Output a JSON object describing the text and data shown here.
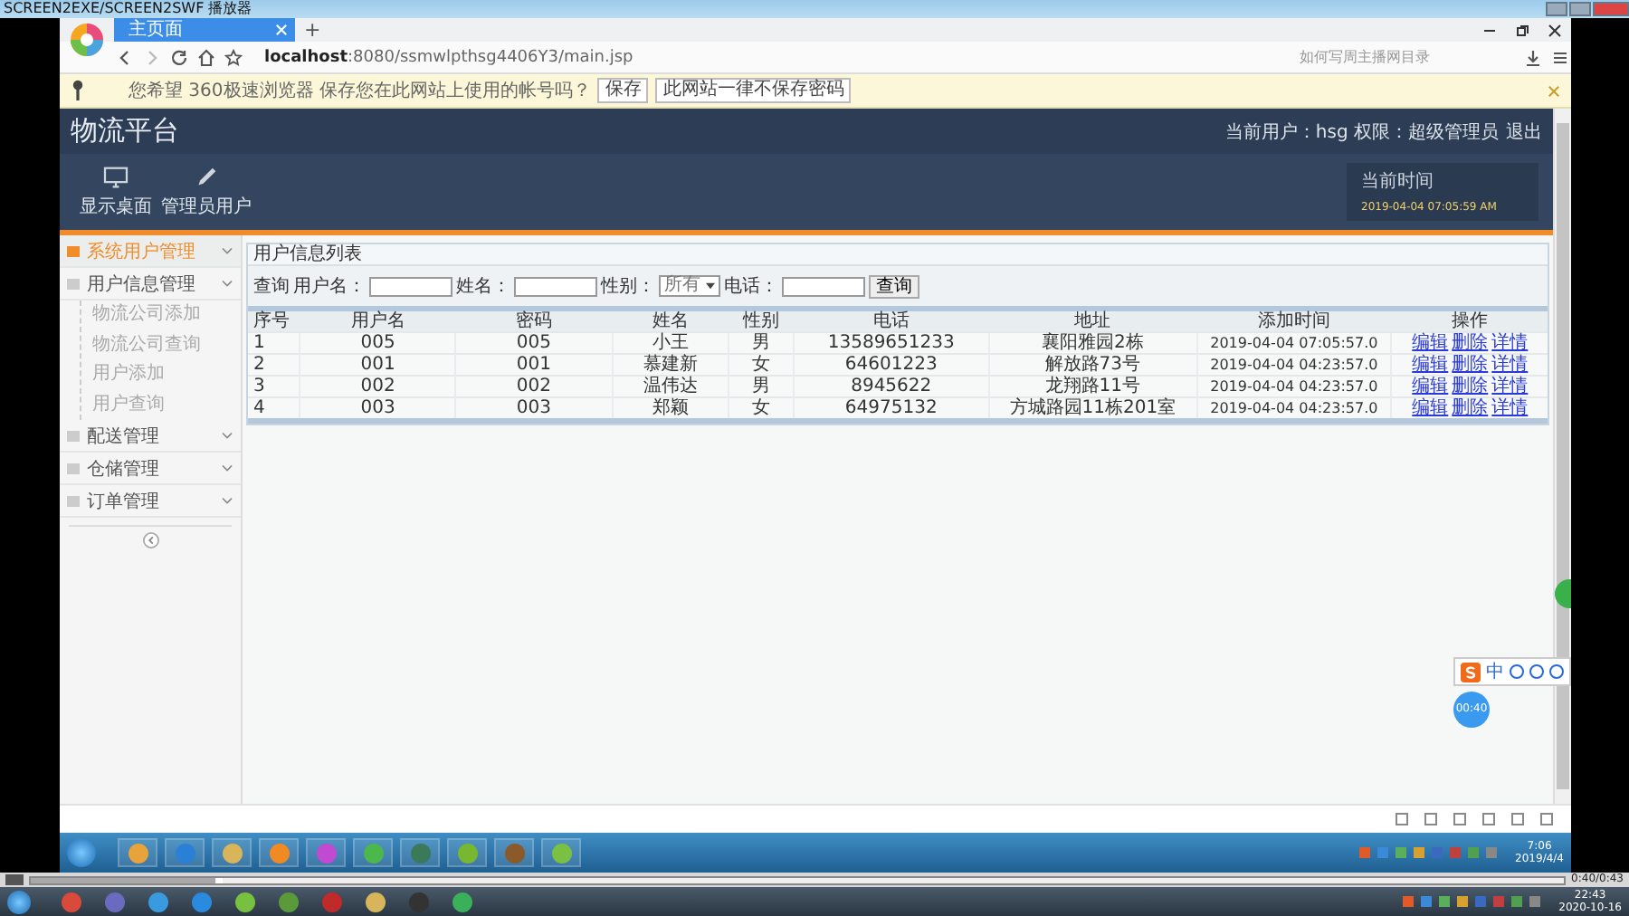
{
  "player": {
    "title": "SCREEN2EXE/SCREEN2SWF 播放器",
    "time": "0:40/0:43",
    "level": 0.12
  },
  "browser": {
    "tabs": [
      {
        "label": "主页面",
        "selected": true
      }
    ],
    "new_tab": "+",
    "url_host": "localhost",
    "url_rest": ":8080/ssmwlpthsg4406Y3/main.jsp",
    "search_placeholder": "如何写周主播网目录"
  },
  "infobar": {
    "message": "您希望 360极速浏览器 保存您在此网站上使用的帐号吗？",
    "buttons": [
      "保存",
      "此网站一律不保存密码"
    ]
  },
  "header": {
    "title": "物流平台",
    "user_info": "当前用户：hsg 权限：超级管理员",
    "logout": "退出"
  },
  "nav": [
    {
      "label": "显示桌面",
      "kind": "monitor"
    },
    {
      "label": "管理员用户",
      "kind": "pencil"
    }
  ],
  "clock_box": {
    "label": "当前时间",
    "value": "2019-04-04 07:05:59 AM"
  },
  "sidebar": {
    "items": [
      {
        "label": "系统用户管理",
        "selected": true
      },
      {
        "label": "用户信息管理",
        "selected": false,
        "children": [
          {
            "label": "物流公司添加"
          },
          {
            "label": "物流公司查询"
          },
          {
            "label": "用户添加"
          },
          {
            "label": "用户查询"
          }
        ]
      },
      {
        "label": "配送管理",
        "selected": false
      },
      {
        "label": "仓储管理",
        "selected": false
      },
      {
        "label": "订单管理",
        "selected": false
      }
    ]
  },
  "panel": {
    "title": "用户信息列表",
    "search": {
      "label": "查询",
      "fields": [
        {
          "label": "用户名：",
          "kind": "input"
        },
        {
          "label": "姓名：",
          "kind": "input"
        },
        {
          "label": "性别：",
          "kind": "select",
          "value": "所有"
        },
        {
          "label": "电话：",
          "kind": "input"
        }
      ],
      "button": "查询"
    },
    "table": {
      "columns": [
        "序号",
        "用户名",
        "密码",
        "姓名",
        "性别",
        "电话",
        "地址",
        "添加时间",
        "操作"
      ],
      "rows": [
        {
          "cells": [
            "1",
            "005",
            "005",
            "小王",
            "男",
            "13589651233",
            "襄阳雅园2栋",
            "2019-04-04 07:05:57.0"
          ],
          "actions": [
            "编辑",
            "删除",
            "详情"
          ]
        },
        {
          "cells": [
            "2",
            "001",
            "001",
            "慕建新",
            "女",
            "64601223",
            "解放路73号",
            "2019-04-04 04:23:57.0"
          ],
          "actions": [
            "编辑",
            "删除",
            "详情"
          ]
        },
        {
          "cells": [
            "3",
            "002",
            "002",
            "温伟达",
            "男",
            "8945622",
            "龙翔路11号",
            "2019-04-04 04:23:57.0"
          ],
          "actions": [
            "编辑",
            "删除",
            "详情"
          ]
        },
        {
          "cells": [
            "4",
            "003",
            "003",
            "郑颖",
            "女",
            "64975132",
            "方城路园11栋201室",
            "2019-04-04 04:23:57.0"
          ],
          "actions": [
            "编辑",
            "删除",
            "详情"
          ]
        }
      ]
    }
  },
  "ime": {
    "label": "中"
  },
  "recorder_badge": "00:40",
  "inner_taskbar": {
    "time": "7:06",
    "date": "2019/4/4"
  },
  "taskbar": {
    "time": "22:43",
    "date": "2020-10-16"
  }
}
